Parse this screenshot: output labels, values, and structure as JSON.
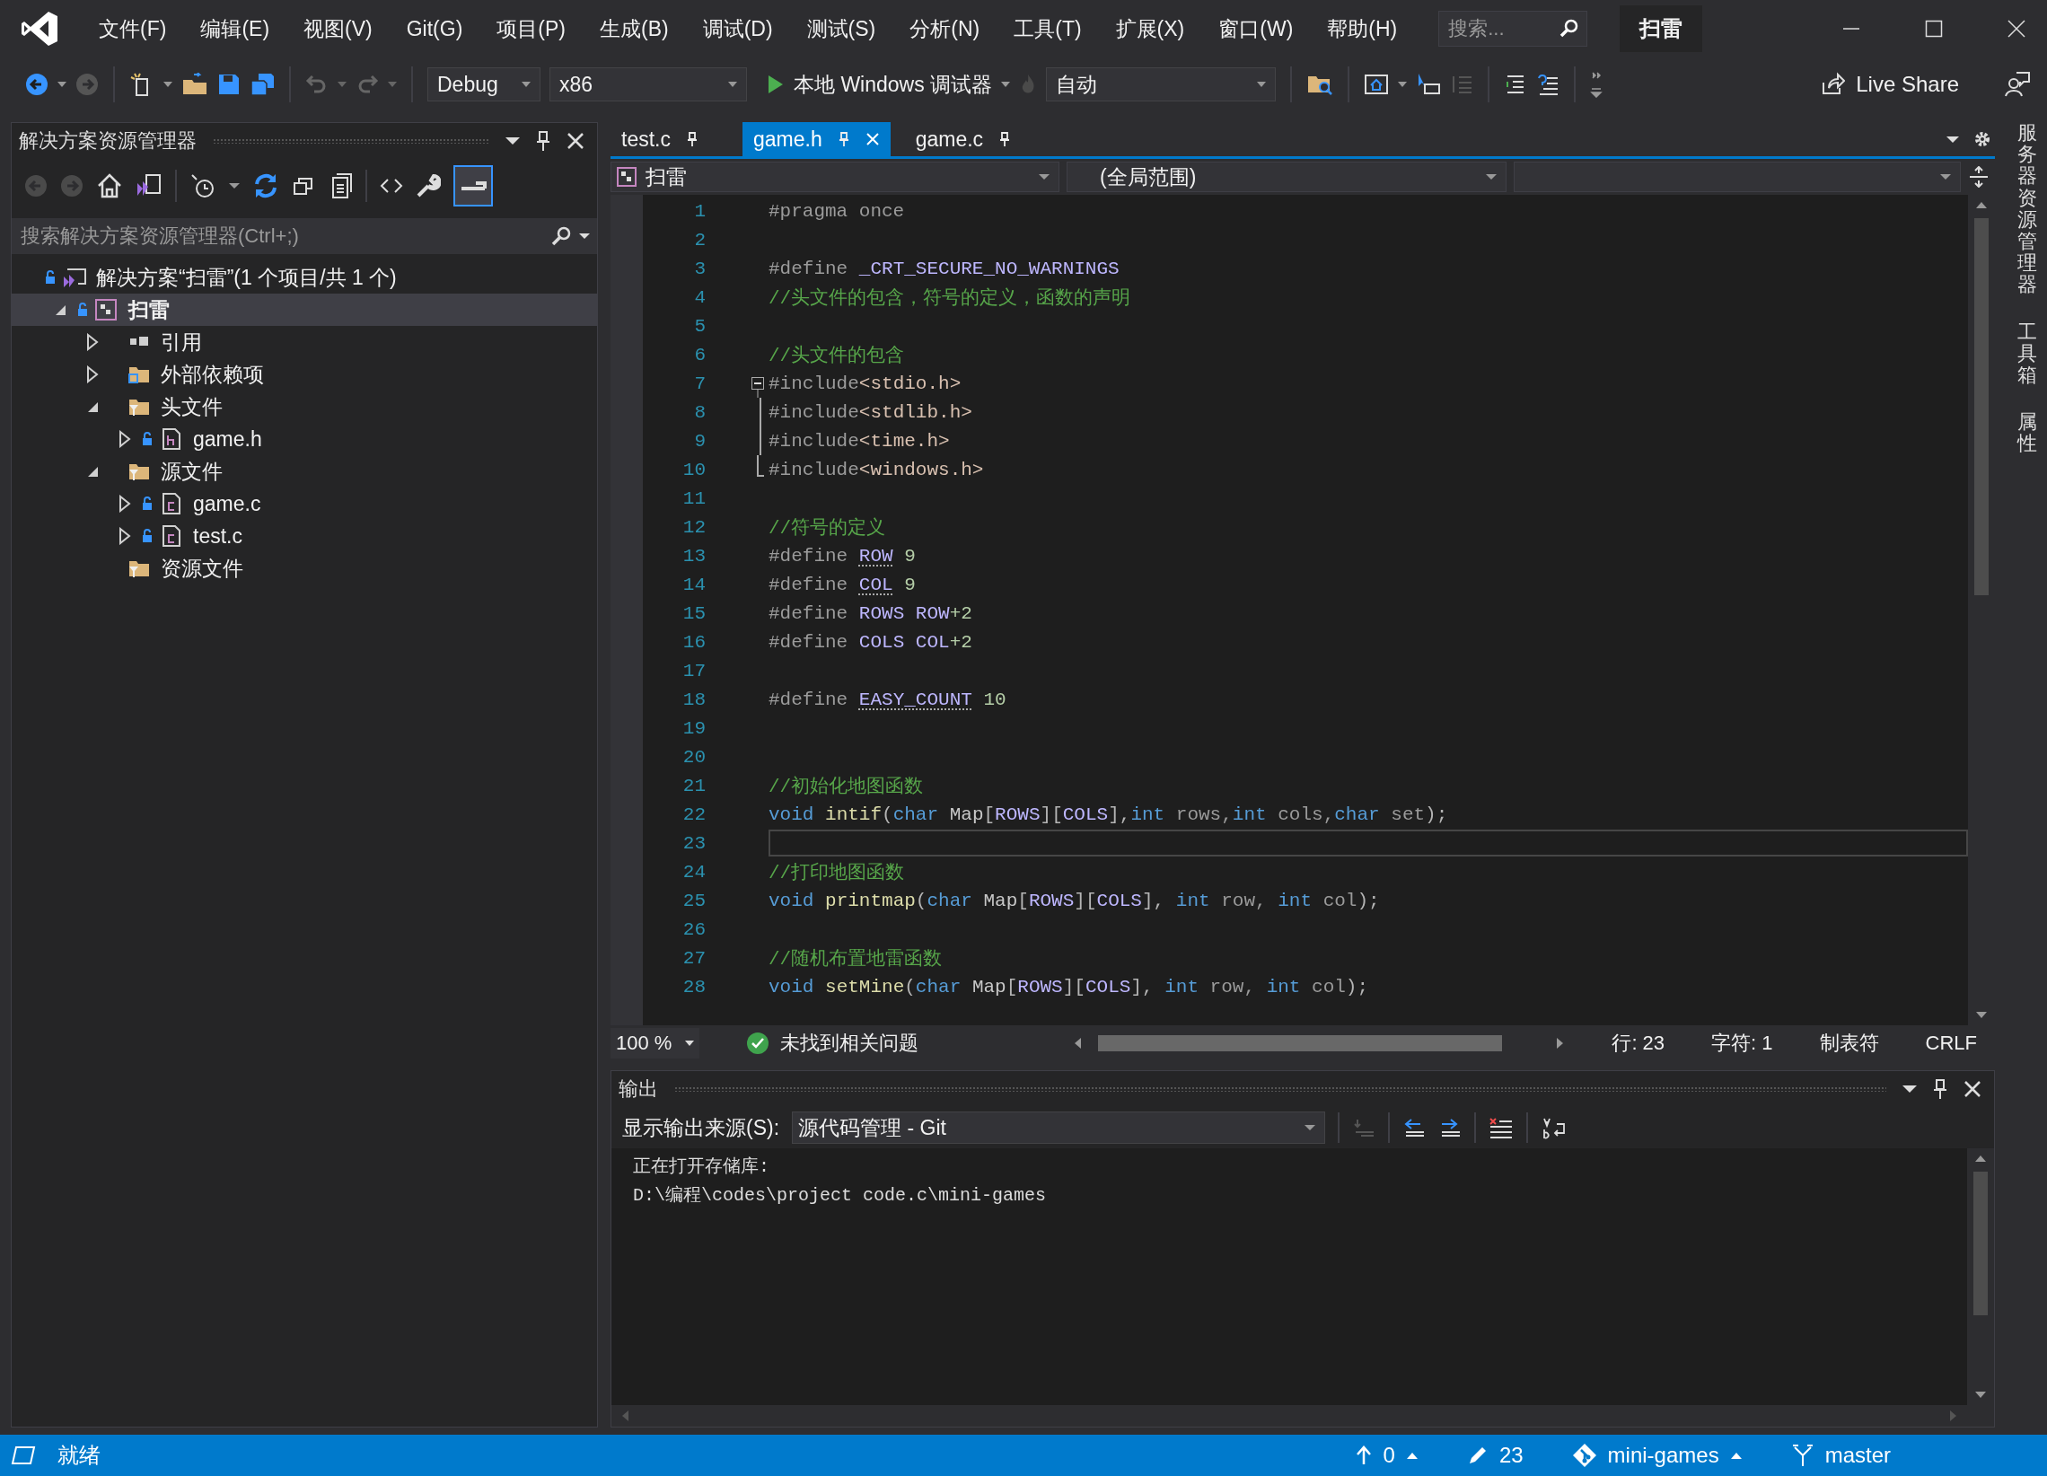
{
  "titlebar": {
    "menus": [
      "文件(F)",
      "编辑(E)",
      "视图(V)",
      "Git(G)",
      "项目(P)",
      "生成(B)",
      "调试(D)",
      "测试(S)",
      "分析(N)",
      "工具(T)",
      "扩展(X)",
      "窗口(W)",
      "帮助(H)"
    ],
    "search_placeholder": "搜索...",
    "title": "扫雷"
  },
  "toolbar": {
    "configuration": "Debug",
    "platform": "x86",
    "debugger": "本地 Windows 调试器",
    "target": "自动",
    "live_share": "Live Share"
  },
  "explorer": {
    "title": "解决方案资源管理器",
    "search_placeholder": "搜索解决方案资源管理器(Ctrl+;)",
    "tree": [
      {
        "label": "解决方案“扫雷”(1 个项目/共 1 个)",
        "kind": "solution",
        "has_expander": false,
        "expanded": true,
        "locked": true,
        "selected": false,
        "children": [
          {
            "label": "扫雷",
            "kind": "project",
            "has_expander": true,
            "expanded": true,
            "locked": true,
            "selected": true,
            "children": [
              {
                "label": "引用",
                "kind": "references",
                "has_expander": true,
                "expanded": false,
                "locked": false,
                "selected": false
              },
              {
                "label": "外部依赖项",
                "kind": "external",
                "has_expander": true,
                "expanded": false,
                "locked": false,
                "selected": false
              },
              {
                "label": "头文件",
                "kind": "filter",
                "has_expander": true,
                "expanded": true,
                "locked": false,
                "selected": false,
                "children": [
                  {
                    "label": "game.h",
                    "kind": "header-file",
                    "has_expander": true,
                    "expanded": false,
                    "locked": true,
                    "selected": false
                  }
                ]
              },
              {
                "label": "源文件",
                "kind": "filter",
                "has_expander": true,
                "expanded": true,
                "locked": false,
                "selected": false,
                "children": [
                  {
                    "label": "game.c",
                    "kind": "source-file",
                    "has_expander": true,
                    "expanded": false,
                    "locked": true,
                    "selected": false
                  },
                  {
                    "label": "test.c",
                    "kind": "source-file",
                    "has_expander": true,
                    "expanded": false,
                    "locked": true,
                    "selected": false
                  }
                ]
              },
              {
                "label": "资源文件",
                "kind": "filter",
                "has_expander": false,
                "expanded": false,
                "locked": false,
                "selected": false
              }
            ]
          }
        ]
      }
    ]
  },
  "editor": {
    "tabs": [
      {
        "label": "test.c",
        "selected": false
      },
      {
        "label": "game.h",
        "selected": true
      },
      {
        "label": "game.c",
        "selected": false
      }
    ],
    "nav": {
      "project": "扫雷",
      "scope": "(全局范围)"
    },
    "lines": [
      {
        "number": "1",
        "current": false,
        "tokens": [
          {
            "kind": "pp",
            "text": "#pragma once"
          }
        ]
      },
      {
        "number": "2",
        "current": false
      },
      {
        "number": "3",
        "current": false,
        "tokens": [
          {
            "kind": "pp",
            "text": "#define "
          },
          {
            "kind": "macro",
            "text": "_CRT_SECURE_NO_WARNINGS"
          }
        ]
      },
      {
        "number": "4",
        "current": false,
        "tokens": [
          {
            "kind": "comment",
            "text": "//头文件的包含，符号的定义，函数的声明"
          }
        ]
      },
      {
        "number": "5",
        "current": false
      },
      {
        "number": "6",
        "current": false,
        "tokens": [
          {
            "kind": "comment",
            "text": "//头文件的包含"
          }
        ]
      },
      {
        "number": "7",
        "current": false,
        "kind": "fold-start",
        "tokens": [
          {
            "kind": "pp",
            "text": "#include"
          },
          {
            "kind": "header",
            "text": "<stdio.h>"
          }
        ]
      },
      {
        "number": "8",
        "current": false,
        "kind": "fold-inside",
        "tokens": [
          {
            "kind": "pp",
            "text": "#include"
          },
          {
            "kind": "header",
            "text": "<stdlib.h>"
          }
        ]
      },
      {
        "number": "9",
        "current": false,
        "kind": "fold-inside",
        "tokens": [
          {
            "kind": "pp",
            "text": "#include"
          },
          {
            "kind": "header",
            "text": "<time.h>"
          }
        ]
      },
      {
        "number": "10",
        "current": false,
        "kind": "fold-end",
        "tokens": [
          {
            "kind": "pp",
            "text": "#include"
          },
          {
            "kind": "header",
            "text": "<windows.h>"
          }
        ]
      },
      {
        "number": "11",
        "current": false
      },
      {
        "number": "12",
        "current": false,
        "tokens": [
          {
            "kind": "comment",
            "text": "//符号的定义"
          }
        ]
      },
      {
        "number": "13",
        "current": false,
        "tokens": [
          {
            "kind": "pp",
            "text": "#define "
          },
          {
            "kind": "macro-hint",
            "text": "ROW"
          },
          {
            "kind": "number",
            "text": " 9"
          }
        ]
      },
      {
        "number": "14",
        "current": false,
        "tokens": [
          {
            "kind": "pp",
            "text": "#define "
          },
          {
            "kind": "macro-hint",
            "text": "COL"
          },
          {
            "kind": "number",
            "text": " 9"
          }
        ]
      },
      {
        "number": "15",
        "current": false,
        "tokens": [
          {
            "kind": "pp",
            "text": "#define "
          },
          {
            "kind": "macro",
            "text": "ROWS ROW"
          },
          {
            "kind": "number",
            "text": "+2"
          }
        ]
      },
      {
        "number": "16",
        "current": false,
        "tokens": [
          {
            "kind": "pp",
            "text": "#define "
          },
          {
            "kind": "macro",
            "text": "COLS COL"
          },
          {
            "kind": "number",
            "text": "+2"
          }
        ]
      },
      {
        "number": "17",
        "current": false
      },
      {
        "number": "18",
        "current": false,
        "tokens": [
          {
            "kind": "pp",
            "text": "#define "
          },
          {
            "kind": "macro-hint",
            "text": "EASY_COUNT"
          },
          {
            "kind": "number",
            "text": " 10"
          }
        ]
      },
      {
        "number": "19",
        "current": false
      },
      {
        "number": "20",
        "current": false
      },
      {
        "number": "21",
        "current": false,
        "tokens": [
          {
            "kind": "comment",
            "text": "//初始化地图函数"
          }
        ]
      },
      {
        "number": "22",
        "current": false,
        "tokens": [
          {
            "kind": "keyword",
            "text": "void"
          },
          {
            "kind": "function",
            "text": " intif"
          },
          {
            "kind": "punct",
            "text": "("
          },
          {
            "kind": "keyword",
            "text": "char"
          },
          {
            "kind": "ident",
            "text": " Map"
          },
          {
            "kind": "punct",
            "text": "["
          },
          {
            "kind": "macro",
            "text": "ROWS"
          },
          {
            "kind": "punct",
            "text": "]["
          },
          {
            "kind": "macro",
            "text": "COLS"
          },
          {
            "kind": "punct",
            "text": "],"
          },
          {
            "kind": "keyword",
            "text": "int"
          },
          {
            "kind": "param",
            "text": " rows,"
          },
          {
            "kind": "keyword",
            "text": "int"
          },
          {
            "kind": "param",
            "text": " cols,"
          },
          {
            "kind": "keyword",
            "text": "char"
          },
          {
            "kind": "param",
            "text": " set"
          },
          {
            "kind": "punct",
            "text": ");"
          }
        ]
      },
      {
        "number": "23",
        "current": true
      },
      {
        "number": "24",
        "current": false,
        "tokens": [
          {
            "kind": "comment",
            "text": "//打印地图函数"
          }
        ]
      },
      {
        "number": "25",
        "current": false,
        "tokens": [
          {
            "kind": "keyword",
            "text": "void"
          },
          {
            "kind": "function",
            "text": " printmap"
          },
          {
            "kind": "punct",
            "text": "("
          },
          {
            "kind": "keyword",
            "text": "char"
          },
          {
            "kind": "ident",
            "text": " Map"
          },
          {
            "kind": "punct",
            "text": "["
          },
          {
            "kind": "macro",
            "text": "ROWS"
          },
          {
            "kind": "punct",
            "text": "]["
          },
          {
            "kind": "macro",
            "text": "COLS"
          },
          {
            "kind": "punct",
            "text": "], "
          },
          {
            "kind": "keyword",
            "text": "int"
          },
          {
            "kind": "param",
            "text": " row, "
          },
          {
            "kind": "keyword",
            "text": "int"
          },
          {
            "kind": "param",
            "text": " col"
          },
          {
            "kind": "punct",
            "text": ");"
          }
        ]
      },
      {
        "number": "26",
        "current": false
      },
      {
        "number": "27",
        "current": false,
        "tokens": [
          {
            "kind": "comment",
            "text": "//随机布置地雷函数"
          }
        ]
      },
      {
        "number": "28",
        "current": false,
        "tokens": [
          {
            "kind": "keyword",
            "text": "void"
          },
          {
            "kind": "function",
            "text": " setMine"
          },
          {
            "kind": "punct",
            "text": "("
          },
          {
            "kind": "keyword",
            "text": "char"
          },
          {
            "kind": "ident",
            "text": " Map"
          },
          {
            "kind": "punct",
            "text": "["
          },
          {
            "kind": "macro",
            "text": "ROWS"
          },
          {
            "kind": "punct",
            "text": "]["
          },
          {
            "kind": "macro",
            "text": "COLS"
          },
          {
            "kind": "punct",
            "text": "], "
          },
          {
            "kind": "keyword",
            "text": "int"
          },
          {
            "kind": "param",
            "text": " row, "
          },
          {
            "kind": "keyword",
            "text": "int"
          },
          {
            "kind": "param",
            "text": " col"
          },
          {
            "kind": "punct",
            "text": ");"
          }
        ]
      }
    ],
    "footer": {
      "zoom": "100 %",
      "issues": "未找到相关问题",
      "line": "行: 23",
      "char": "字符: 1",
      "indent": "制表符",
      "eol": "CRLF"
    }
  },
  "output": {
    "title": "输出",
    "source_label": "显示输出来源(S):",
    "source": "源代码管理 - Git",
    "lines": [
      "正在打开存储库:",
      "D:\\编程\\codes\\project code.c\\mini-games"
    ]
  },
  "side_tabs": [
    "服务器资源管理器",
    "工具箱",
    "属性"
  ],
  "status_bar": {
    "state": "就绪",
    "unpushed": "0",
    "changes": "23",
    "repository": "mini-games",
    "branch": "master"
  }
}
